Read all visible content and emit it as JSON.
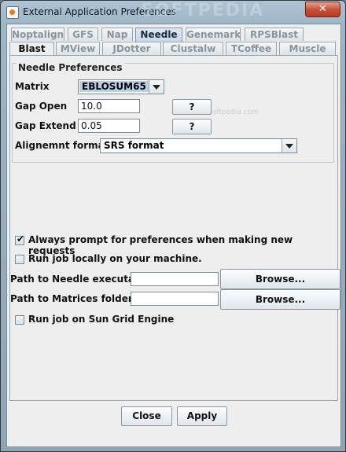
{
  "window": {
    "title": "External Application Preferences",
    "watermark": "SOFTPEDIA",
    "close_glyph": "✕"
  },
  "tabs_row1": [
    "Noptalign",
    "GFS",
    "Nap",
    "Needle",
    "Genemark",
    "RPSBlast"
  ],
  "tabs_row2": [
    "Blast",
    "MView",
    "JDotter",
    "Clustalw",
    "TCoffee",
    "Muscle"
  ],
  "selected_tab": "Needle",
  "needle": {
    "legend": "Needle Preferences",
    "softpedia_mark": "www.softpedia.com",
    "matrix_label": "Matrix",
    "matrix_value": "EBLOSUM65",
    "gap_open_label": "Gap Open",
    "gap_open_value": "10.0",
    "gap_open_help": "?",
    "gap_extend_label": "Gap Extend",
    "gap_extend_value": "0.05",
    "gap_extend_help": "?",
    "format_label": "Alignemnt format",
    "format_value": "SRS format"
  },
  "options": {
    "always_prompt_label": "Always prompt for preferences when making new requests",
    "always_prompt_checked": true,
    "run_local_label": "Run job locally on your machine.",
    "run_local_checked": false,
    "needle_path_label": "Path to Needle executable.",
    "needle_path_value": "",
    "matrices_path_label": "Path to Matrices folder.",
    "matrices_path_value": "",
    "browse_label": "Browse...",
    "sge_label": "Run job on Sun Grid Engine",
    "sge_checked": false
  },
  "footer": {
    "close_label": "Close",
    "apply_label": "Apply"
  },
  "colors": {
    "selected_tab": "#c4d8ec",
    "window_frame": "#9fb6c7",
    "close_button": "#c8503a"
  }
}
